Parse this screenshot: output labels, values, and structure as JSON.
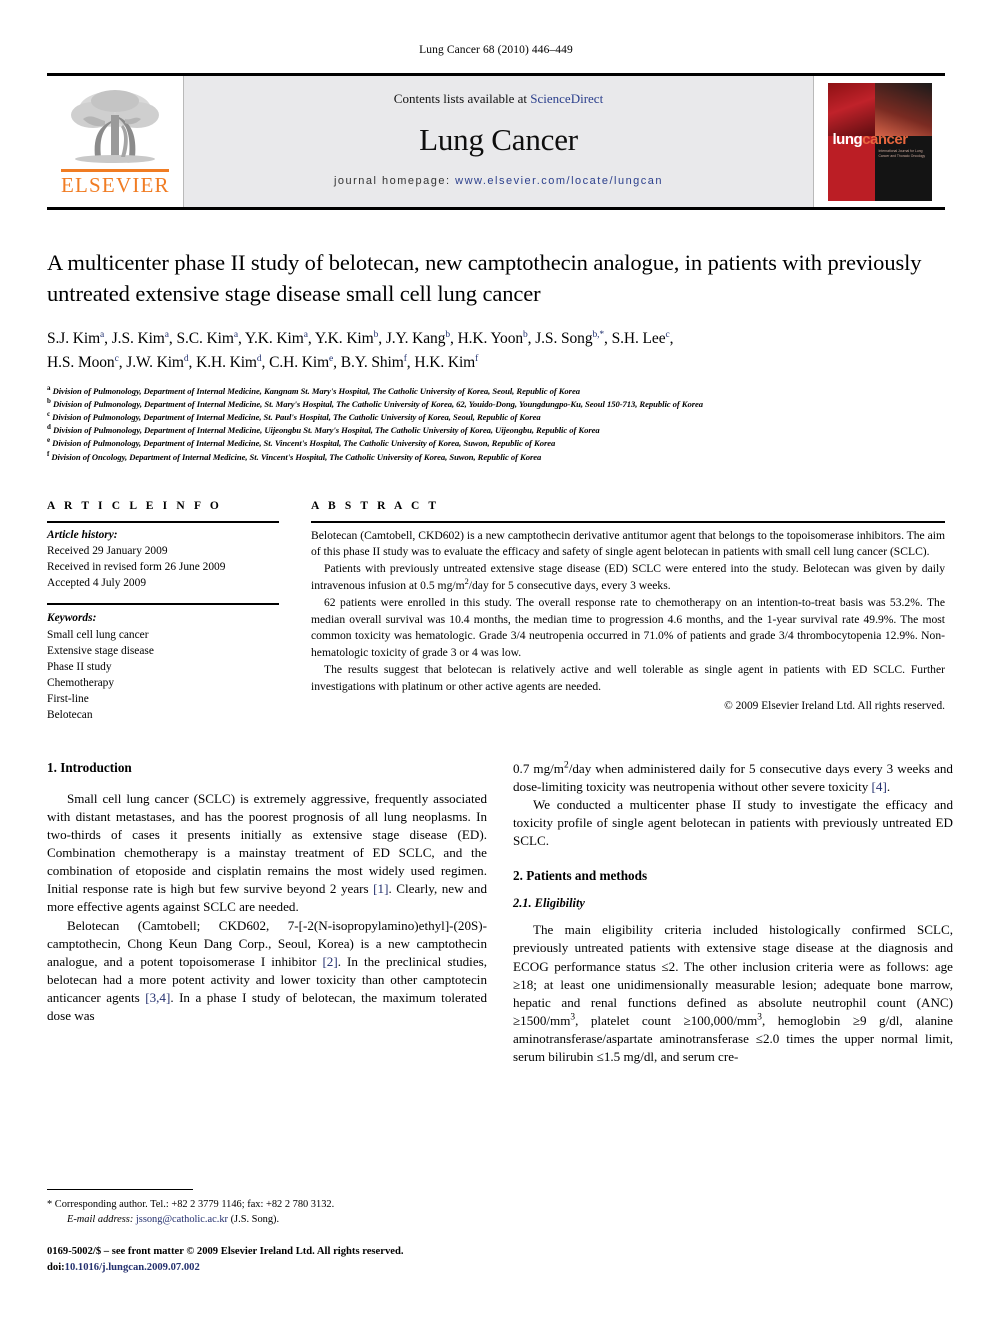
{
  "running_head": "Lung Cancer 68 (2010) 446–449",
  "masthead": {
    "publisher_name": "ELSEVIER",
    "contents_prefix": "Contents lists available at ",
    "contents_link": "ScienceDirect",
    "journal_title": "Lung Cancer",
    "homepage_prefix": "journal homepage:",
    "homepage_url": "www.elsevier.com/locate/lungcan",
    "cover": {
      "word1": "lung",
      "word2": "cancer",
      "subtitle": "International Journal for Lung Cancer and Thoracic Oncology"
    }
  },
  "article": {
    "title": "A multicenter phase II study of belotecan, new camptothecin analogue, in patients with previously untreated extensive stage disease small cell lung cancer",
    "authors_line1": "S.J. Kim, J.S. Kim, S.C. Kim, Y.K. Kim, Y.K. Kim, J.Y. Kang, H.K. Yoon, J.S. Song, S.H. Lee,",
    "authors_line2": "H.S. Moon, J.W. Kim, K.H. Kim, C.H. Kim, B.Y. Shim, H.K. Kim",
    "authors": [
      {
        "name": "S.J. Kim",
        "sup": "a"
      },
      {
        "name": "J.S. Kim",
        "sup": "a"
      },
      {
        "name": "S.C. Kim",
        "sup": "a"
      },
      {
        "name": "Y.K. Kim",
        "sup": "a"
      },
      {
        "name": "Y.K. Kim",
        "sup": "b"
      },
      {
        "name": "J.Y. Kang",
        "sup": "b"
      },
      {
        "name": "H.K. Yoon",
        "sup": "b"
      },
      {
        "name": "J.S. Song",
        "sup": "b,*"
      },
      {
        "name": "S.H. Lee",
        "sup": "c"
      },
      {
        "name": "H.S. Moon",
        "sup": "c"
      },
      {
        "name": "J.W. Kim",
        "sup": "d"
      },
      {
        "name": "K.H. Kim",
        "sup": "d"
      },
      {
        "name": "C.H. Kim",
        "sup": "e"
      },
      {
        "name": "B.Y. Shim",
        "sup": "f"
      },
      {
        "name": "H.K. Kim",
        "sup": "f"
      }
    ],
    "affiliations": [
      {
        "sup": "a",
        "text": "Division of Pulmonology, Department of Internal Medicine, Kangnam St. Mary's Hospital, The Catholic University of Korea, Seoul, Republic of Korea"
      },
      {
        "sup": "b",
        "text": "Division of Pulmonology, Department of Internal Medicine, St. Mary's Hospital, The Catholic University of Korea, 62, Youido-Dong, Youngdungpo-Ku, Seoul 150-713, Republic of Korea"
      },
      {
        "sup": "c",
        "text": "Division of Pulmonology, Department of Internal Medicine, St. Paul's Hospital, The Catholic University of Korea, Seoul, Republic of Korea"
      },
      {
        "sup": "d",
        "text": "Division of Pulmonology, Department of Internal Medicine, Uijeongbu St. Mary's Hospital, The Catholic University of Korea, Uijeongbu, Republic of Korea"
      },
      {
        "sup": "e",
        "text": "Division of Pulmonology, Department of Internal Medicine, St. Vincent's Hospital, The Catholic University of Korea, Suwon, Republic of Korea"
      },
      {
        "sup": "f",
        "text": "Division of Oncology, Department of Internal Medicine, St. Vincent's Hospital, The Catholic University of Korea, Suwon, Republic of Korea"
      }
    ]
  },
  "article_info": {
    "heading": "A R T I C L E  I N F O",
    "history_label": "Article history:",
    "history": [
      "Received 29 January 2009",
      "Received in revised form 26 June 2009",
      "Accepted 4 July 2009"
    ],
    "keywords_label": "Keywords:",
    "keywords": [
      "Small cell lung cancer",
      "Extensive stage disease",
      "Phase II study",
      "Chemotherapy",
      "First-line",
      "Belotecan"
    ]
  },
  "abstract": {
    "heading": "A B S T R A C T",
    "paragraphs": [
      "Belotecan (Camtobell, CKD602) is a new camptothecin derivative antitumor agent that belongs to the topoisomerase inhibitors. The aim of this phase II study was to evaluate the efficacy and safety of single agent belotecan in patients with small cell lung cancer (SCLC).",
      "Patients with previously untreated extensive stage disease (ED) SCLC were entered into the study. Belotecan was given by daily intravenous infusion at 0.5 mg/m2/day for 5 consecutive days, every 3 weeks.",
      "62 patients were enrolled in this study. The overall response rate to chemotherapy on an intention-to-treat basis was 53.2%. The median overall survival was 10.4 months, the median time to progression 4.6 months, and the 1-year survival rate 49.9%. The most common toxicity was hematologic. Grade 3/4 neutropenia occurred in 71.0% of patients and grade 3/4 thrombocytopenia 12.9%. Non-hematologic toxicity of grade 3 or 4 was low.",
      "The results suggest that belotecan is relatively active and well tolerable as single agent in patients with ED SCLC. Further investigations with platinum or other active agents are needed."
    ],
    "copyright": "© 2009 Elsevier Ireland Ltd. All rights reserved."
  },
  "sections": {
    "introduction_heading": "1.  Introduction",
    "intro_p1": "Small cell lung cancer (SCLC) is extremely aggressive, frequently associated with distant metastases, and has the poorest prognosis of all lung neoplasms. In two-thirds of cases it presents initially as extensive stage disease (ED). Combination chemotherapy is a mainstay treatment of ED SCLC, and the combination of etoposide and cisplatin remains the most widely used regimen. Initial response rate is high but few survive beyond 2 years [1]. Clearly, new and more effective agents against SCLC are needed.",
    "intro_p2": "Belotecan (Camtobell; CKD602, 7-[-2(N-isopropylamino)ethyl]-(20S)-camptothecin, Chong Keun Dang Corp., Seoul, Korea) is a new camptothecin analogue, and a potent topoisomerase I inhibitor [2]. In the preclinical studies, belotecan had a more potent activity and lower toxicity than other camptotecin anticancer agents [3,4]. In a phase I study of belotecan, the maximum tolerated dose was",
    "intro_p3": "0.7 mg/m2/day when administered daily for 5 consecutive days every 3 weeks and dose-limiting toxicity was neutropenia without other severe toxicity [4].",
    "intro_p4": "We conducted a multicenter phase II study to investigate the efficacy and toxicity profile of single agent belotecan in patients with previously untreated ED SCLC.",
    "methods_heading": "2.  Patients and methods",
    "eligibility_heading": "2.1.  Eligibility",
    "eligibility_p1": "The main eligibility criteria included histologically confirmed SCLC, previously untreated patients with extensive stage disease at the diagnosis and ECOG performance status ≤2. The other inclusion criteria were as follows: age ≥18; at least one unidimensionally measurable lesion; adequate bone marrow, hepatic and renal functions defined as absolute neutrophil count (ANC) ≥1500/mm3, platelet count ≥100,000/mm3, hemoglobin ≥9 g/dl, alanine aminotransferase/aspartate aminotransferase ≤2.0 times the upper normal limit, serum bilirubin ≤1.5 mg/dl, and serum cre-"
  },
  "footnotes": {
    "corresponding": "* Corresponding author. Tel.: +82 2 3779 1146; fax: +82 2 780 3132.",
    "email_label": "E-mail address:",
    "email": "jssong@catholic.ac.kr",
    "email_suffix": "(J.S. Song).",
    "issn_line": "0169-5002/$ – see front matter © 2009 Elsevier Ireland Ltd. All rights reserved.",
    "doi_label": "doi:",
    "doi_value": "10.1016/j.lungcan.2009.07.002"
  }
}
